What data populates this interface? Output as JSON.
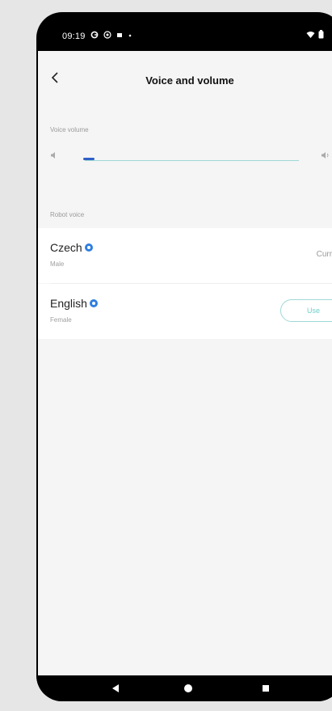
{
  "status_bar": {
    "time": "09:19",
    "left_icons": [
      "google-icon",
      "location-icon",
      "notification-icon",
      "dot-icon"
    ],
    "right_icons": [
      "wifi-icon",
      "battery-icon"
    ]
  },
  "header": {
    "title": "Voice and volume",
    "back_icon": "chevron-left-icon"
  },
  "volume": {
    "section_label": "Voice volume",
    "level": 0.0
  },
  "robot_voice": {
    "section_label": "Robot voice",
    "voices": [
      {
        "name": "Czech",
        "gender": "Male",
        "status": "Current"
      },
      {
        "name": "English",
        "gender": "Female",
        "action": "Use"
      }
    ]
  },
  "nav_bar": {
    "buttons": [
      "back-triangle-icon",
      "home-circle-icon",
      "recents-square-icon"
    ]
  },
  "colors": {
    "accent": "#6ccfcb",
    "thumb": "#2f5fc7",
    "badge": "#2f7ee0",
    "background": "#f5f5f5"
  }
}
